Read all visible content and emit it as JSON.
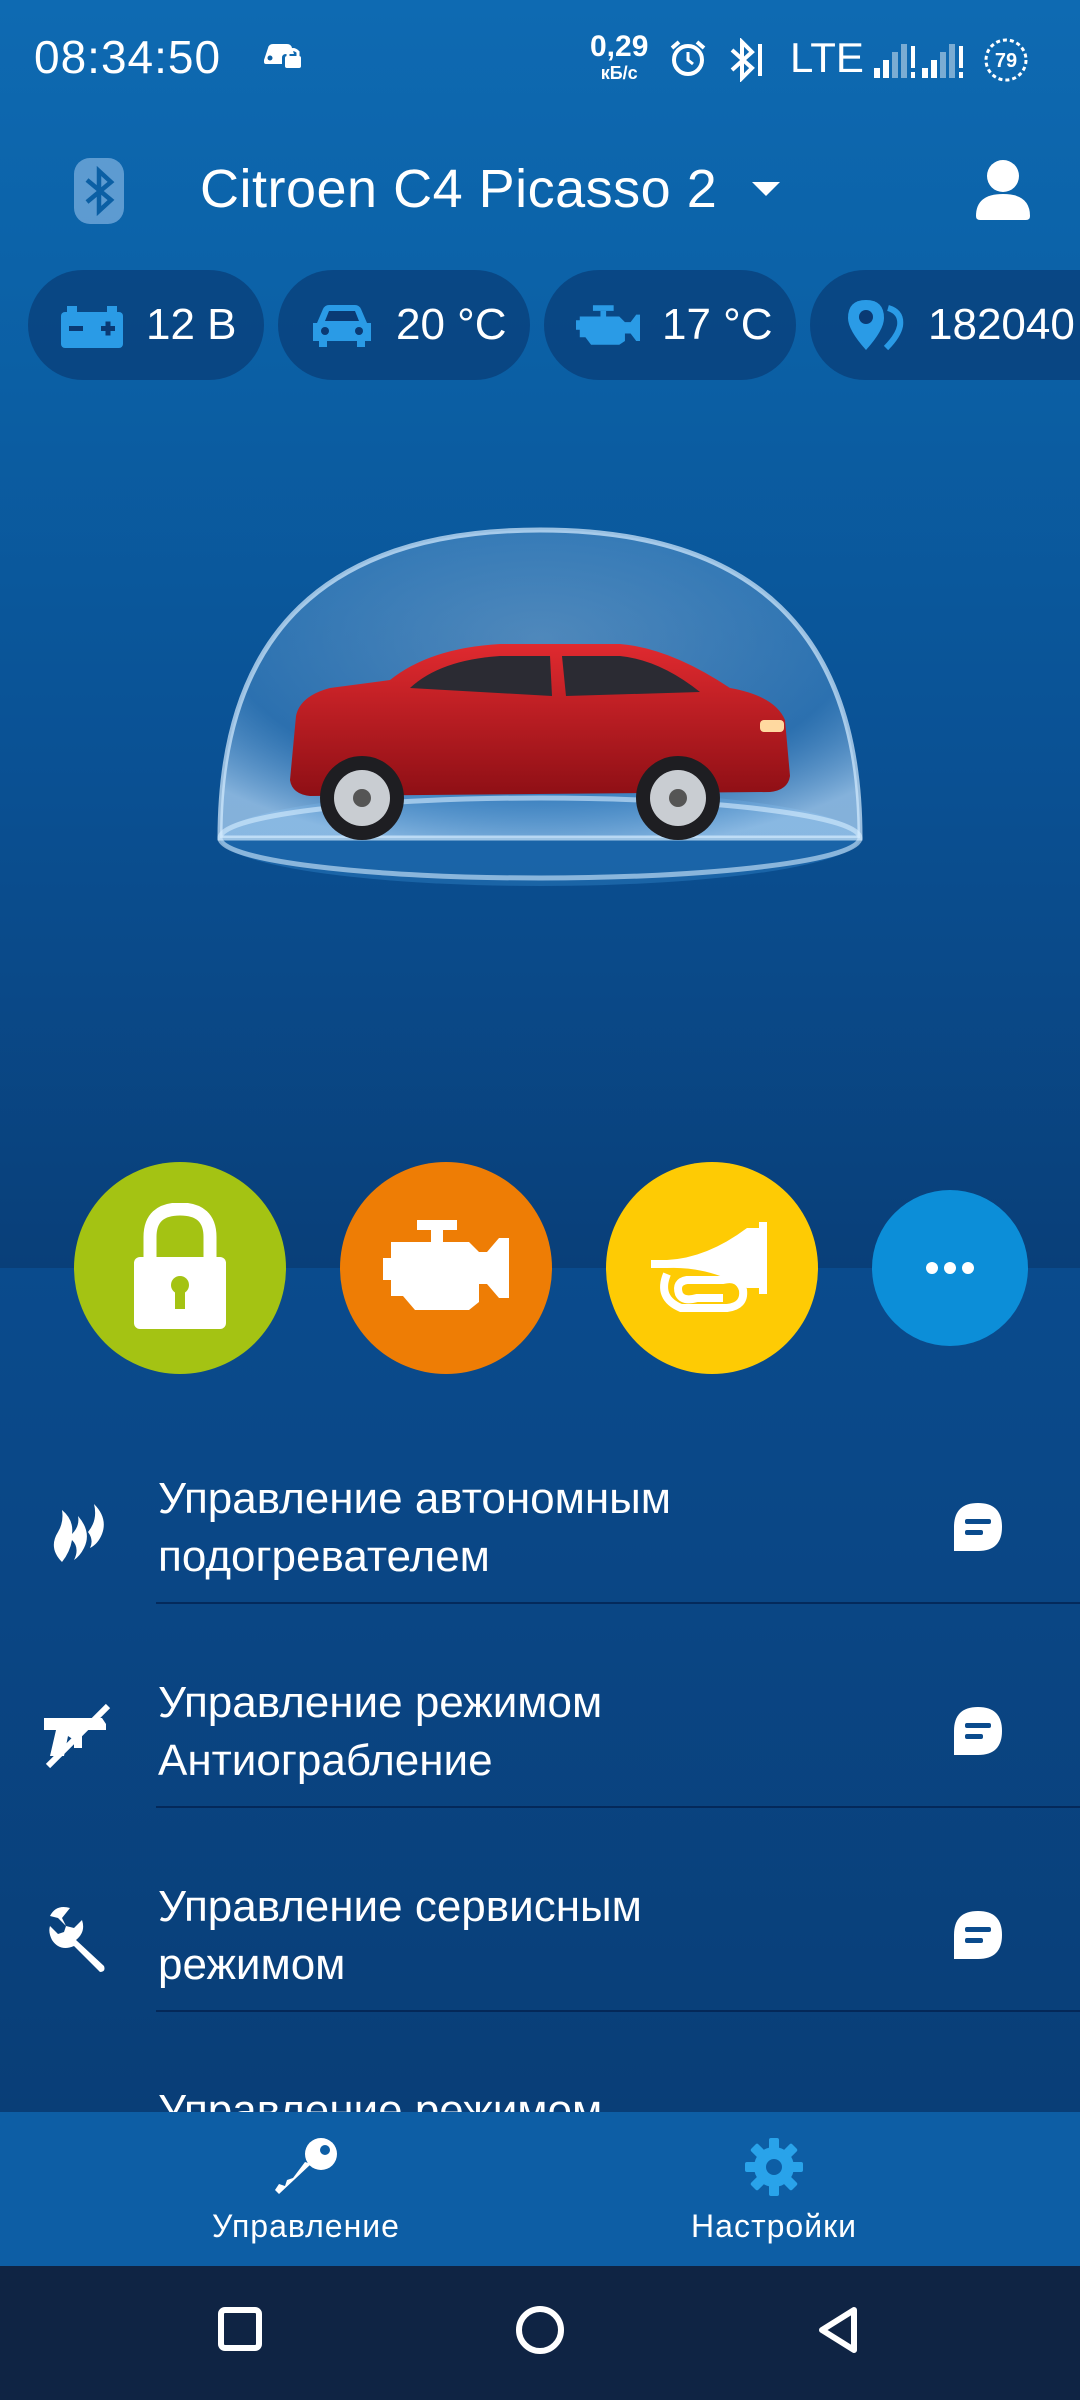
{
  "status_bar": {
    "time": "08:34:50",
    "net_speed_value": "0,29",
    "net_speed_unit": "кБ/с",
    "network": "LTE",
    "battery": "79"
  },
  "header": {
    "vehicle_name": "Citroen C4 Picasso 2"
  },
  "chips": [
    {
      "icon": "battery-icon",
      "value": "12 В"
    },
    {
      "icon": "car-icon",
      "value": "20 °C"
    },
    {
      "icon": "engine-icon",
      "value": "17 °C"
    },
    {
      "icon": "location-icon",
      "value": "182040"
    }
  ],
  "colors": {
    "lock": "#a4c313",
    "engine": "#ee7d05",
    "horn": "#fecb04",
    "more": "#0c8ed8",
    "background_top": "#0e6ab2",
    "background_bottom": "#093e77"
  },
  "actions": [
    {
      "name": "lock",
      "icon": "lock-icon"
    },
    {
      "name": "engine-start",
      "icon": "engine-icon"
    },
    {
      "name": "horn",
      "icon": "horn-icon"
    },
    {
      "name": "more",
      "icon": "more-icon"
    }
  ],
  "menu": [
    {
      "icon": "flame-icon",
      "label_line1": "Управление автономным",
      "label_line2": "подогревателем"
    },
    {
      "icon": "anti-robbery-icon",
      "label_line1": "Управление режимом",
      "label_line2": "Антиограбление"
    },
    {
      "icon": "wrench-icon",
      "label_line1": "Управление сервисным",
      "label_line2": "режимом"
    },
    {
      "icon": "sensor-icon",
      "label_line1": "Управление режимом",
      "label_line2": ""
    }
  ],
  "bottom_nav": {
    "control_label": "Управление",
    "settings_label": "Настройки"
  }
}
